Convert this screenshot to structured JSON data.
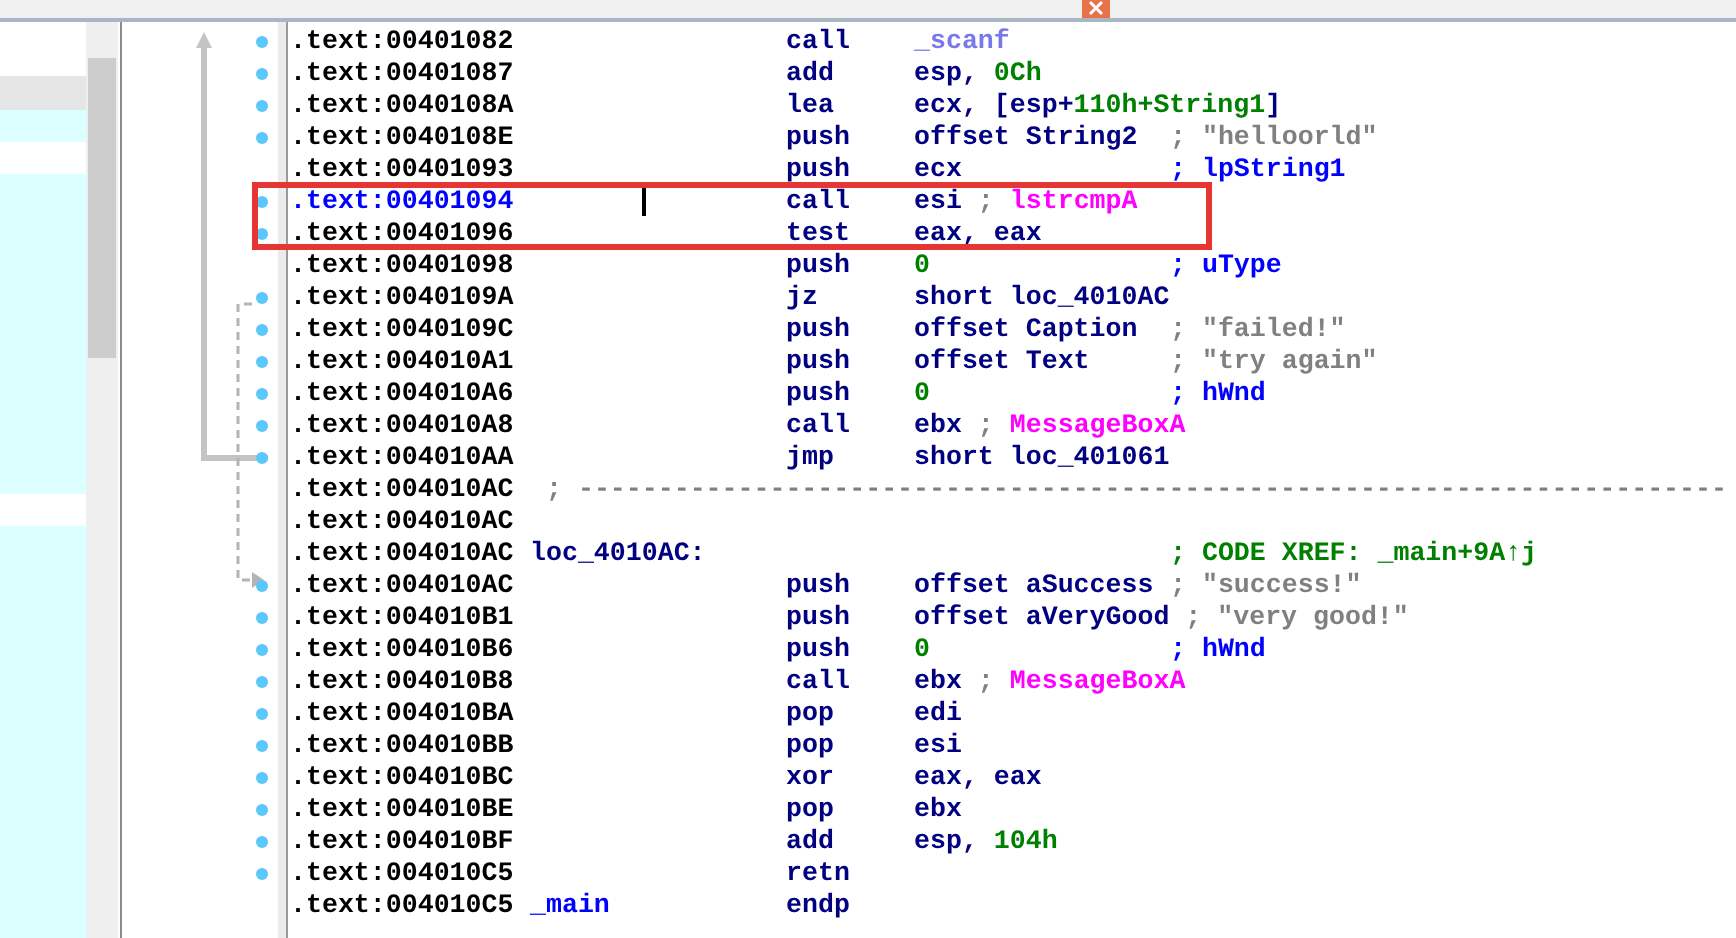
{
  "listing": {
    "lines": [
      {
        "kind": "code",
        "address": ".text:00401082",
        "dot": true,
        "selected": false,
        "mnemonic": "call",
        "operands": [
          {
            "text": "_scanf",
            "kind": "import"
          }
        ]
      },
      {
        "kind": "code",
        "address": ".text:00401087",
        "dot": true,
        "selected": false,
        "mnemonic": "add",
        "operands": [
          {
            "text": "esp, ",
            "kind": "plain"
          },
          {
            "text": "0Ch",
            "kind": "number"
          }
        ]
      },
      {
        "kind": "code",
        "address": ".text:0040108A",
        "dot": true,
        "selected": false,
        "mnemonic": "lea",
        "operands": [
          {
            "text": "ecx, [esp+",
            "kind": "plain"
          },
          {
            "text": "110h+String1",
            "kind": "number"
          },
          {
            "text": "]",
            "kind": "plain"
          }
        ]
      },
      {
        "kind": "code",
        "address": ".text:0040108E",
        "dot": true,
        "selected": false,
        "mnemonic": "push",
        "operands": [
          {
            "text": "offset String2",
            "kind": "plain"
          }
        ],
        "comment": {
          "text": "; \"helloorld\"",
          "kind": "string"
        }
      },
      {
        "kind": "code",
        "address": ".text:00401093",
        "dot": false,
        "selected": false,
        "mnemonic": "push",
        "operands": [
          {
            "text": "ecx",
            "kind": "plain"
          }
        ],
        "comment": {
          "text": "; lpString1",
          "kind": "var"
        }
      },
      {
        "kind": "code",
        "address": ".text:00401094",
        "dot": true,
        "selected": true,
        "mnemonic": "call",
        "operands": [
          {
            "text": "esi",
            "kind": "plain"
          },
          {
            "text": " ; ",
            "kind": "punct"
          },
          {
            "text": "lstrcmpA",
            "kind": "api"
          }
        ]
      },
      {
        "kind": "code",
        "address": ".text:00401096",
        "dot": true,
        "selected": false,
        "mnemonic": "test",
        "operands": [
          {
            "text": "eax, eax",
            "kind": "plain"
          }
        ]
      },
      {
        "kind": "code",
        "address": ".text:00401098",
        "dot": false,
        "selected": false,
        "mnemonic": "push",
        "operands": [
          {
            "text": "0",
            "kind": "number"
          }
        ],
        "comment": {
          "text": "; uType",
          "kind": "var"
        }
      },
      {
        "kind": "code",
        "address": ".text:0040109A",
        "dot": true,
        "selected": false,
        "mnemonic": "jz",
        "operands": [
          {
            "text": "short loc_4010AC",
            "kind": "plain"
          }
        ]
      },
      {
        "kind": "code",
        "address": ".text:0040109C",
        "dot": true,
        "selected": false,
        "mnemonic": "push",
        "operands": [
          {
            "text": "offset Caption",
            "kind": "plain"
          }
        ],
        "comment": {
          "text": "; \"failed!\"",
          "kind": "string"
        }
      },
      {
        "kind": "code",
        "address": ".text:004010A1",
        "dot": true,
        "selected": false,
        "mnemonic": "push",
        "operands": [
          {
            "text": "offset Text",
            "kind": "plain"
          }
        ],
        "comment": {
          "text": "; \"try again\"",
          "kind": "string"
        }
      },
      {
        "kind": "code",
        "address": ".text:004010A6",
        "dot": true,
        "selected": false,
        "mnemonic": "push",
        "operands": [
          {
            "text": "0",
            "kind": "number"
          }
        ],
        "comment": {
          "text": "; hWnd",
          "kind": "var"
        }
      },
      {
        "kind": "code",
        "address": ".text:004010A8",
        "dot": true,
        "selected": false,
        "mnemonic": "call",
        "operands": [
          {
            "text": "ebx",
            "kind": "plain"
          },
          {
            "text": " ; ",
            "kind": "punct"
          },
          {
            "text": "MessageBoxA",
            "kind": "api"
          }
        ]
      },
      {
        "kind": "code",
        "address": ".text:004010AA",
        "dot": true,
        "selected": false,
        "mnemonic": "jmp",
        "operands": [
          {
            "text": "short loc_401061",
            "kind": "plain"
          }
        ]
      },
      {
        "kind": "separator",
        "address": ".text:004010AC",
        "dot": false,
        "selected": false,
        "comment": {
          "text": "; ------------------------------------------------------------------------",
          "kind": "rule"
        }
      },
      {
        "kind": "code",
        "address": ".text:004010AC",
        "dot": false,
        "selected": false
      },
      {
        "kind": "code",
        "address": ".text:004010AC",
        "dot": false,
        "selected": false,
        "label": {
          "text": "loc_4010AC:",
          "kind": "loc"
        },
        "comment": {
          "text": "; CODE XREF: _main+9A↑j",
          "kind": "xref"
        }
      },
      {
        "kind": "code",
        "address": ".text:004010AC",
        "dot": true,
        "selected": false,
        "mnemonic": "push",
        "operands": [
          {
            "text": "offset aSuccess",
            "kind": "plain"
          }
        ],
        "comment": {
          "text": "; \"success!\"",
          "kind": "string"
        }
      },
      {
        "kind": "code",
        "address": ".text:004010B1",
        "dot": true,
        "selected": false,
        "mnemonic": "push",
        "operands": [
          {
            "text": "offset aVeryGood",
            "kind": "plain"
          }
        ],
        "comment": {
          "text": "; \"very good!\"",
          "kind": "string"
        }
      },
      {
        "kind": "code",
        "address": ".text:004010B6",
        "dot": true,
        "selected": false,
        "mnemonic": "push",
        "operands": [
          {
            "text": "0",
            "kind": "number"
          }
        ],
        "comment": {
          "text": "; hWnd",
          "kind": "var"
        }
      },
      {
        "kind": "code",
        "address": ".text:004010B8",
        "dot": true,
        "selected": false,
        "mnemonic": "call",
        "operands": [
          {
            "text": "ebx",
            "kind": "plain"
          },
          {
            "text": " ; ",
            "kind": "punct"
          },
          {
            "text": "MessageBoxA",
            "kind": "api"
          }
        ]
      },
      {
        "kind": "code",
        "address": ".text:004010BA",
        "dot": true,
        "selected": false,
        "mnemonic": "pop",
        "operands": [
          {
            "text": "edi",
            "kind": "plain"
          }
        ]
      },
      {
        "kind": "code",
        "address": ".text:004010BB",
        "dot": true,
        "selected": false,
        "mnemonic": "pop",
        "operands": [
          {
            "text": "esi",
            "kind": "plain"
          }
        ]
      },
      {
        "kind": "code",
        "address": ".text:004010BC",
        "dot": true,
        "selected": false,
        "mnemonic": "xor",
        "operands": [
          {
            "text": "eax, eax",
            "kind": "plain"
          }
        ]
      },
      {
        "kind": "code",
        "address": ".text:004010BE",
        "dot": true,
        "selected": false,
        "mnemonic": "pop",
        "operands": [
          {
            "text": "ebx",
            "kind": "plain"
          }
        ]
      },
      {
        "kind": "code",
        "address": ".text:004010BF",
        "dot": true,
        "selected": false,
        "mnemonic": "add",
        "operands": [
          {
            "text": "esp, ",
            "kind": "plain"
          },
          {
            "text": "104h",
            "kind": "number"
          }
        ]
      },
      {
        "kind": "code",
        "address": ".text:004010C5",
        "dot": true,
        "selected": false,
        "mnemonic": "retn"
      },
      {
        "kind": "code",
        "address": ".text:004010C5",
        "dot": false,
        "selected": false,
        "label": {
          "text": "_main",
          "kind": "proc"
        },
        "mnemonic": "endp"
      }
    ]
  }
}
